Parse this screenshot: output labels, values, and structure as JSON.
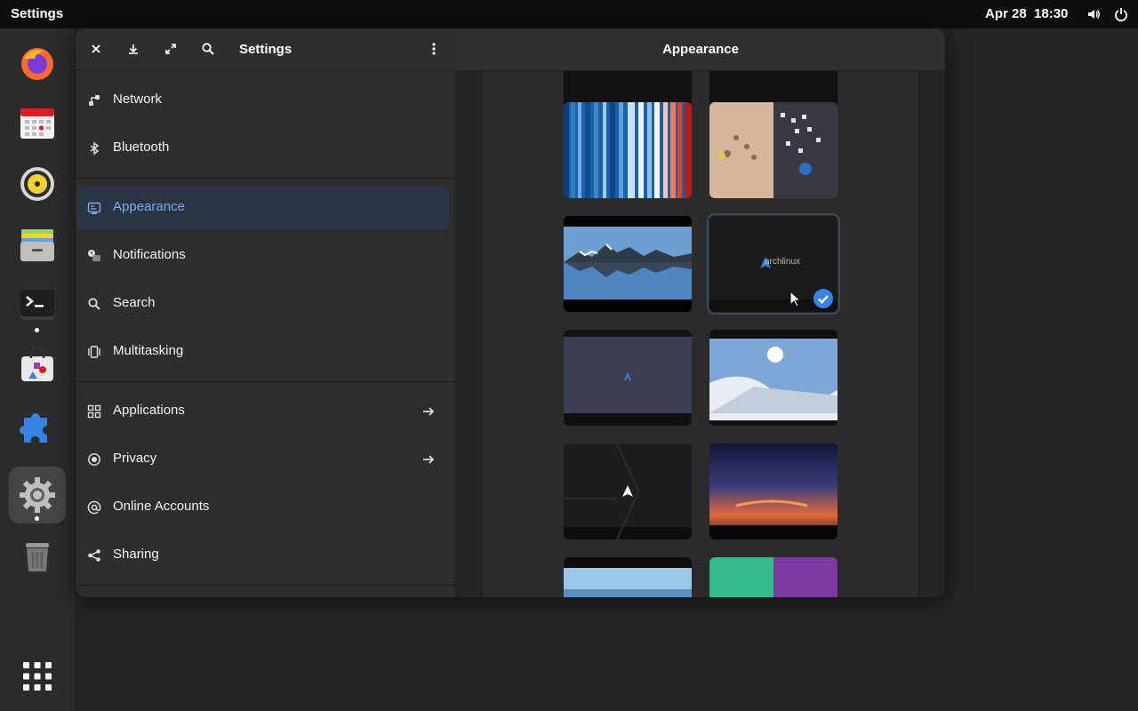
{
  "topbar": {
    "activities_label": "Settings",
    "date": "Apr 28",
    "time": "18:30"
  },
  "dock": {
    "items": [
      {
        "name": "firefox"
      },
      {
        "name": "calendar"
      },
      {
        "name": "rhythmbox"
      },
      {
        "name": "files"
      },
      {
        "name": "terminal"
      },
      {
        "name": "software"
      },
      {
        "name": "extensions"
      },
      {
        "name": "settings"
      },
      {
        "name": "trash"
      },
      {
        "name": "show-apps"
      }
    ]
  },
  "window": {
    "sidebar_title": "Settings",
    "content_title": "Appearance",
    "nav": [
      {
        "label": "Network",
        "icon": "network-icon"
      },
      {
        "label": "Bluetooth",
        "icon": "bluetooth-icon"
      },
      {
        "label": "Appearance",
        "icon": "appearance-icon",
        "selected": true
      },
      {
        "label": "Notifications",
        "icon": "notifications-icon"
      },
      {
        "label": "Search",
        "icon": "search-icon"
      },
      {
        "label": "Multitasking",
        "icon": "multitasking-icon"
      },
      {
        "label": "Applications",
        "icon": "applications-icon",
        "arrow": true
      },
      {
        "label": "Privacy",
        "icon": "privacy-icon",
        "arrow": true
      },
      {
        "label": "Online Accounts",
        "icon": "online-accounts-icon"
      },
      {
        "label": "Sharing",
        "icon": "sharing-icon"
      }
    ],
    "wallpapers": {
      "selected_caption": "archlinux",
      "items": [
        {
          "name": "warming-stripes"
        },
        {
          "name": "desk-items"
        },
        {
          "name": "mountain-reflection"
        },
        {
          "name": "archlinux-dark",
          "selected": true
        },
        {
          "name": "arch-blue-minimal"
        },
        {
          "name": "snowy-slope"
        },
        {
          "name": "arch-dark-geometric"
        },
        {
          "name": "sunset-sky"
        },
        {
          "name": "blue-horizon"
        },
        {
          "name": "green-purple-split"
        }
      ]
    }
  }
}
